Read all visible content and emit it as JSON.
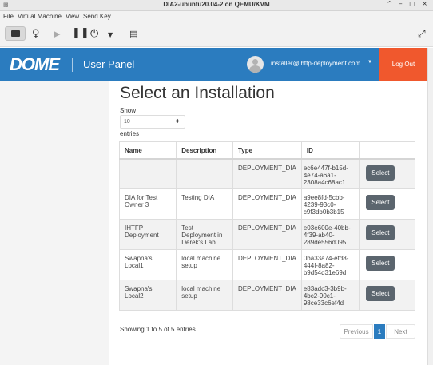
{
  "window": {
    "title": "DIA2-ubuntu20.04-2 on QEMU/KVM",
    "controls": "^ – □ ×"
  },
  "menubar": [
    "File",
    "Virtual Machine",
    "View",
    "Send Key"
  ],
  "app": {
    "logo": "DOME",
    "panel_title": "User Panel",
    "user_email": "installer@ihtfp-deployment.com",
    "logout_label": "Log Out",
    "colors": {
      "navbar": "#2b7cbf",
      "logout": "#f0582d",
      "button": "#5b656e"
    }
  },
  "main": {
    "title": "Select an Installation",
    "show_label": "Show",
    "page_length": "10",
    "entries_label": "entries",
    "columns": [
      "Name",
      "Description",
      "Type",
      "ID",
      ""
    ],
    "rows": [
      {
        "name": "",
        "description": "",
        "type": "DEPLOYMENT_DIA",
        "id": "ec6e447f-b15d-4e74-a6a1-2308a4c68ac1",
        "action": "Select"
      },
      {
        "name": "DIA for Test Owner 3",
        "description": "Testing DIA",
        "type": "DEPLOYMENT_DIA",
        "id": "a9ee8fd-5cbb-4239-93c0-c9f3db0b3b15",
        "action": "Select"
      },
      {
        "name": "IHTFP Deployment",
        "description": "Test Deployment in Derek's Lab",
        "type": "DEPLOYMENT_DIA",
        "id": "e03e600e-40bb-4f39-ab40-289de556d095",
        "action": "Select"
      },
      {
        "name": "Swapna's Local1",
        "description": "local machine setup",
        "type": "DEPLOYMENT_DIA",
        "id": "0ba33a74-efd8-444f-8a82-b9d54d31e69d",
        "action": "Select"
      },
      {
        "name": "Swapna's Local2",
        "description": "local machine setup",
        "type": "DEPLOYMENT_DIA",
        "id": "e83adc3-3b9b-4bc2-90c1-98ce33c6ef4d",
        "action": "Select"
      }
    ],
    "info": "Showing 1 to 5 of 5 entries",
    "pagination": {
      "previous": "Previous",
      "current": "1",
      "next": "Next"
    }
  }
}
